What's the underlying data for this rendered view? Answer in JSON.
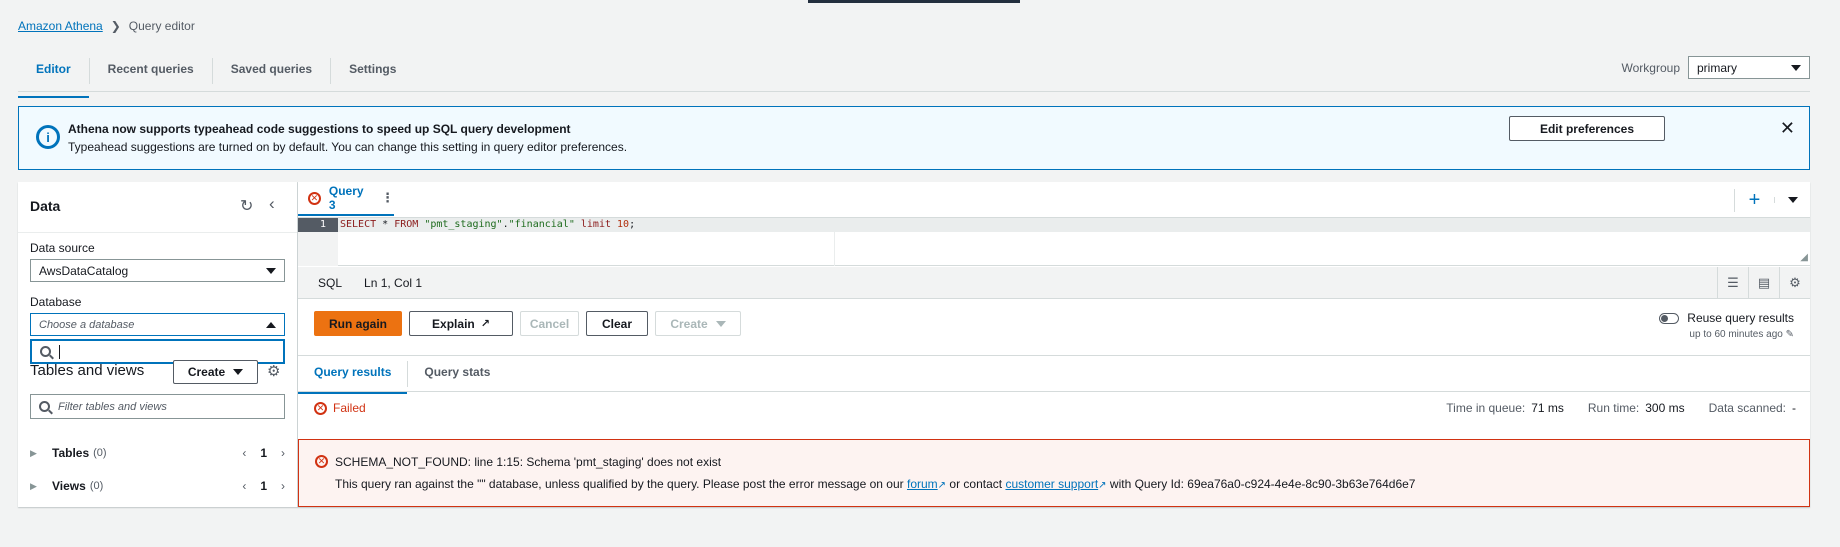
{
  "breadcrumb": {
    "root": "Amazon Athena",
    "current": "Query editor"
  },
  "tabs": [
    "Editor",
    "Recent queries",
    "Saved queries",
    "Settings"
  ],
  "workgroup": {
    "label": "Workgroup",
    "value": "primary"
  },
  "banner": {
    "title": "Athena now supports typeahead code suggestions to speed up SQL query development",
    "description": "Typeahead suggestions are turned on by default. You can change this setting in query editor preferences.",
    "button": "Edit preferences"
  },
  "data_panel": {
    "title": "Data",
    "data_source_label": "Data source",
    "data_source_value": "AwsDataCatalog",
    "database_label": "Database",
    "database_placeholder": "Choose a database",
    "tables_and_views": "Tables and views",
    "create_label": "Create",
    "filter_placeholder": "Filter tables and views",
    "tables": {
      "label": "Tables",
      "count": "(0)",
      "page": "1"
    },
    "views": {
      "label": "Views",
      "count": "(0)",
      "page": "1"
    }
  },
  "query_tab": {
    "label": "Query 3"
  },
  "editor": {
    "line_number": "1"
  },
  "status_bar": {
    "language": "SQL",
    "position": "Ln 1, Col 1"
  },
  "actions": {
    "run_again": "Run again",
    "explain": "Explain",
    "cancel": "Cancel",
    "clear": "Clear",
    "create": "Create"
  },
  "reuse": {
    "label": "Reuse query results",
    "sub": "up to 60 minutes ago"
  },
  "results_tabs": [
    "Query results",
    "Query stats"
  ],
  "result": {
    "status": "Failed",
    "time_in_queue_label": "Time in queue:",
    "time_in_queue": "71 ms",
    "run_time_label": "Run time:",
    "run_time": "300 ms",
    "data_scanned_label": "Data scanned:",
    "data_scanned": "-"
  },
  "error": {
    "line1": "SCHEMA_NOT_FOUND: line 1:15: Schema 'pmt_staging' does not exist",
    "line2_pre": "This query ran against the \"\" database, unless qualified by the query. Please post the error message on our",
    "forum": "forum",
    "or_contact": "or contact",
    "support": "customer support",
    "line2_post": "with Query Id: 69ea76a0-c924-4e4e-8c90-3b63e764d6e7"
  },
  "colors": {
    "accent": "#0073bb",
    "primary_button": "#ec7211",
    "error": "#d13212"
  }
}
